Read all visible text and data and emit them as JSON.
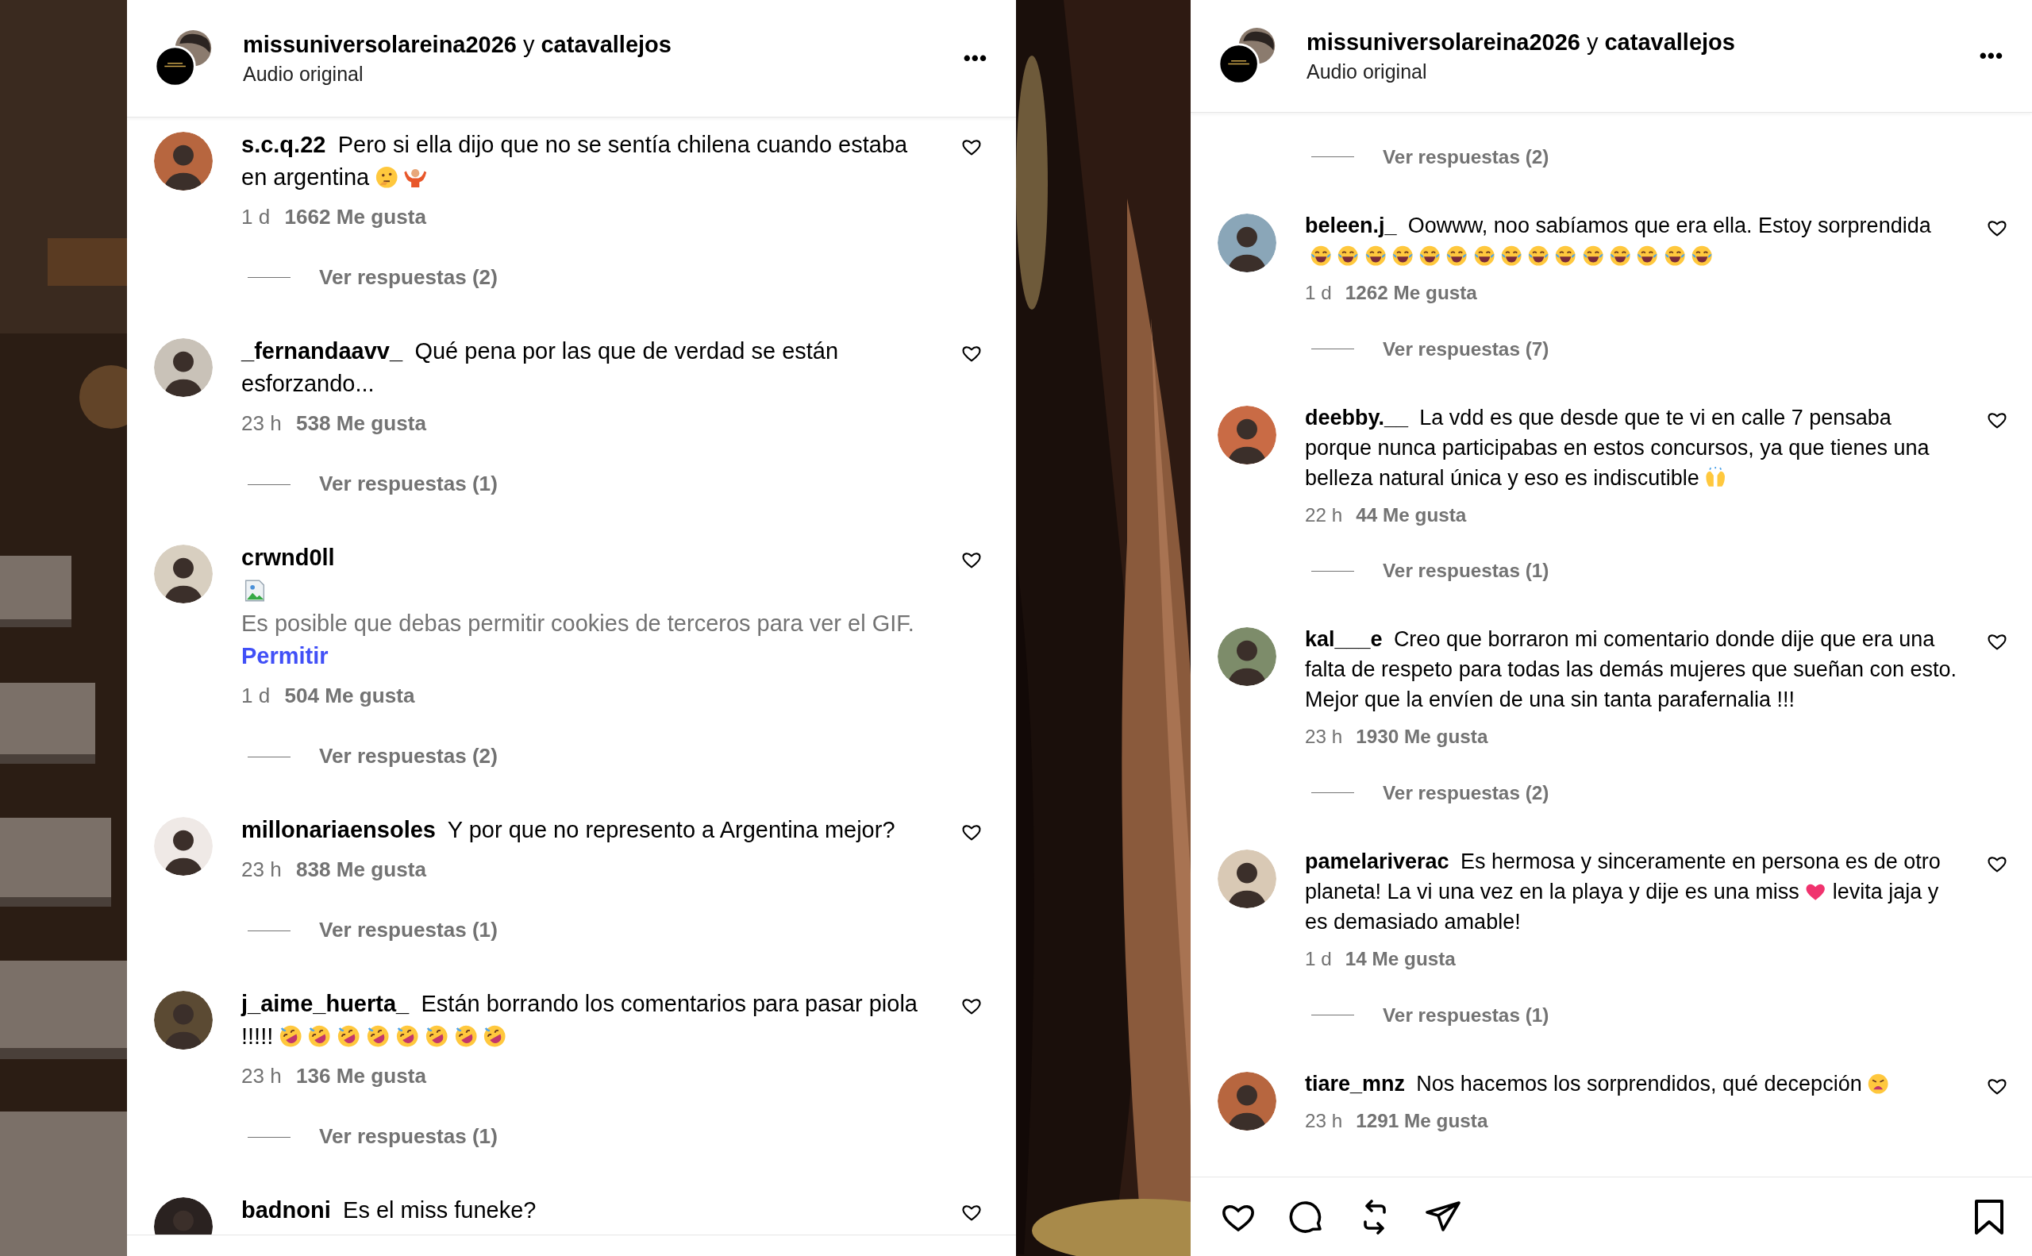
{
  "panels": [
    {
      "kind": "comments",
      "header": {
        "owner": "missuniversolareina2026",
        "joiner": "y",
        "collaborator": "catavallejos",
        "subtitle": "Audio original",
        "menu": "•••"
      },
      "comments": [
        {
          "user": "s.c.q.22",
          "text": "Pero si ella dijo que no se sentía chilena cuando estaba en argentina",
          "emojis": [
            {
              "kind": "thinking"
            },
            {
              "kind": "shrug"
            }
          ],
          "time": "1 d",
          "likes": "1662 Me gusta",
          "replies": "Ver respuestas (2)"
        },
        {
          "user": "_fernandaavv_",
          "text": "Qué pena por las que de verdad se están esforzando...",
          "time": "23 h",
          "likes": "538 Me gusta",
          "replies": "Ver respuestas (1)"
        },
        {
          "user": "crwnd0ll",
          "notice": "Es posible que debas permitir cookies de terceros para ver el GIF.",
          "notice_link": "Permitir",
          "time": "1 d",
          "likes": "504 Me gusta",
          "replies": "Ver respuestas (2)"
        },
        {
          "user": "millonariaensoles",
          "text": "Y por que no represento a Argentina mejor?",
          "time": "23 h",
          "likes": "838 Me gusta",
          "replies": "Ver respuestas (1)"
        },
        {
          "user": "j_aime_huerta_",
          "text": "Están borrando los comentarios para pasar piola !!!!!",
          "emojis": [
            {
              "kind": "rofl"
            },
            {
              "kind": "rofl"
            },
            {
              "kind": "rofl"
            },
            {
              "kind": "rofl"
            },
            {
              "kind": "rofl"
            },
            {
              "kind": "rofl"
            },
            {
              "kind": "rofl"
            },
            {
              "kind": "rofl"
            }
          ],
          "time": "23 h",
          "likes": "136 Me gusta",
          "replies": "Ver respuestas (1)"
        },
        {
          "user": "badnoni",
          "text": "Es el miss funeke?"
        }
      ]
    },
    {
      "kind": "comments-with-actions",
      "header": {
        "owner": "missuniversolareina2026",
        "joiner": "y",
        "collaborator": "catavallejos",
        "subtitle": "Audio original",
        "menu": "•••"
      },
      "comments": [
        {
          "replies": "Ver respuestas (2)"
        },
        {
          "user": "beleen.j_",
          "text": "Oowww, noo sabíamos que era ella. Estoy sorprendida",
          "emojis": [
            {
              "kind": "joy"
            },
            {
              "kind": "joy"
            },
            {
              "kind": "joy"
            },
            {
              "kind": "joy"
            },
            {
              "kind": "joy"
            },
            {
              "kind": "joy"
            },
            {
              "kind": "joy"
            },
            {
              "kind": "joy"
            },
            {
              "kind": "joy"
            },
            {
              "kind": "joy"
            },
            {
              "kind": "joy"
            },
            {
              "kind": "joy"
            },
            {
              "kind": "joy"
            },
            {
              "kind": "joy"
            },
            {
              "kind": "joy"
            }
          ],
          "time": "1 d",
          "likes": "1262 Me gusta",
          "replies": "Ver respuestas (7)"
        },
        {
          "user": "deebby.__",
          "text": "La vdd es que desde que te vi en calle 7 pensaba porque nunca participabas en estos concursos, ya que tienes una belleza natural única y eso es indiscutible",
          "emojis": [
            {
              "kind": "raised-hands"
            }
          ],
          "time": "22 h",
          "likes": "44 Me gusta",
          "replies": "Ver respuestas (1)"
        },
        {
          "user": "kal___e",
          "text": "Creo que borraron mi comentario donde dije que era una falta de respeto para todas las demás mujeres que sueñan con esto. Mejor que la envíen de una sin tanta parafernalia !!!",
          "time": "23 h",
          "likes": "1930 Me gusta",
          "replies": "Ver respuestas (2)"
        },
        {
          "user": "pamelariverac",
          "text": "Es hermosa y sinceramente en persona es de otro planeta! La vi una vez en la playa y dije es una miss",
          "emojis": [
            {
              "kind": "heart"
            }
          ],
          "text_after": "levita jaja y es demasiado amable!",
          "time": "1 d",
          "likes": "14 Me gusta",
          "replies": "Ver respuestas (1)"
        },
        {
          "user": "tiare_mnz",
          "text": "Nos hacemos los sorprendidos, qué decepción",
          "emojis": [
            {
              "kind": "weary"
            }
          ],
          "time": "23 h",
          "likes": "1291 Me gusta"
        }
      ]
    }
  ]
}
